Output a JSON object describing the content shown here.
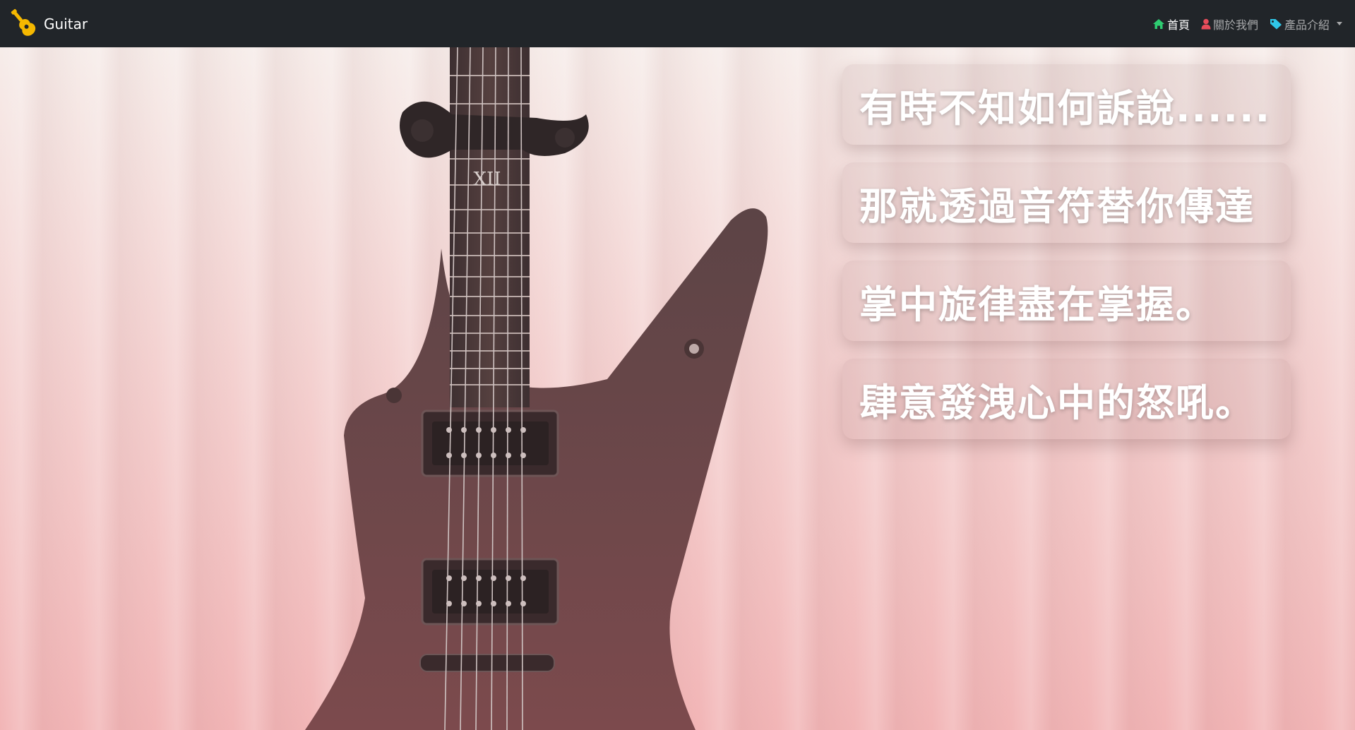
{
  "navbar": {
    "brand": "Guitar",
    "links": [
      {
        "label": "首頁",
        "icon": "home-icon",
        "color": "#2ecc71",
        "active": true
      },
      {
        "label": "關於我們",
        "icon": "user-icon",
        "color": "#e74c5a",
        "active": false
      },
      {
        "label": "產品介紹",
        "icon": "tag-icon",
        "color": "#2fc7e8",
        "active": false,
        "dropdown": true
      }
    ],
    "logo_color": "#f5b800"
  },
  "hero": {
    "background": "electric-guitar-photo",
    "lines": [
      "有時不知如何訴說......",
      "那就透過音符替你傳達",
      "掌中旋律盡在掌握。",
      "肆意發洩心中的怒吼。"
    ]
  }
}
